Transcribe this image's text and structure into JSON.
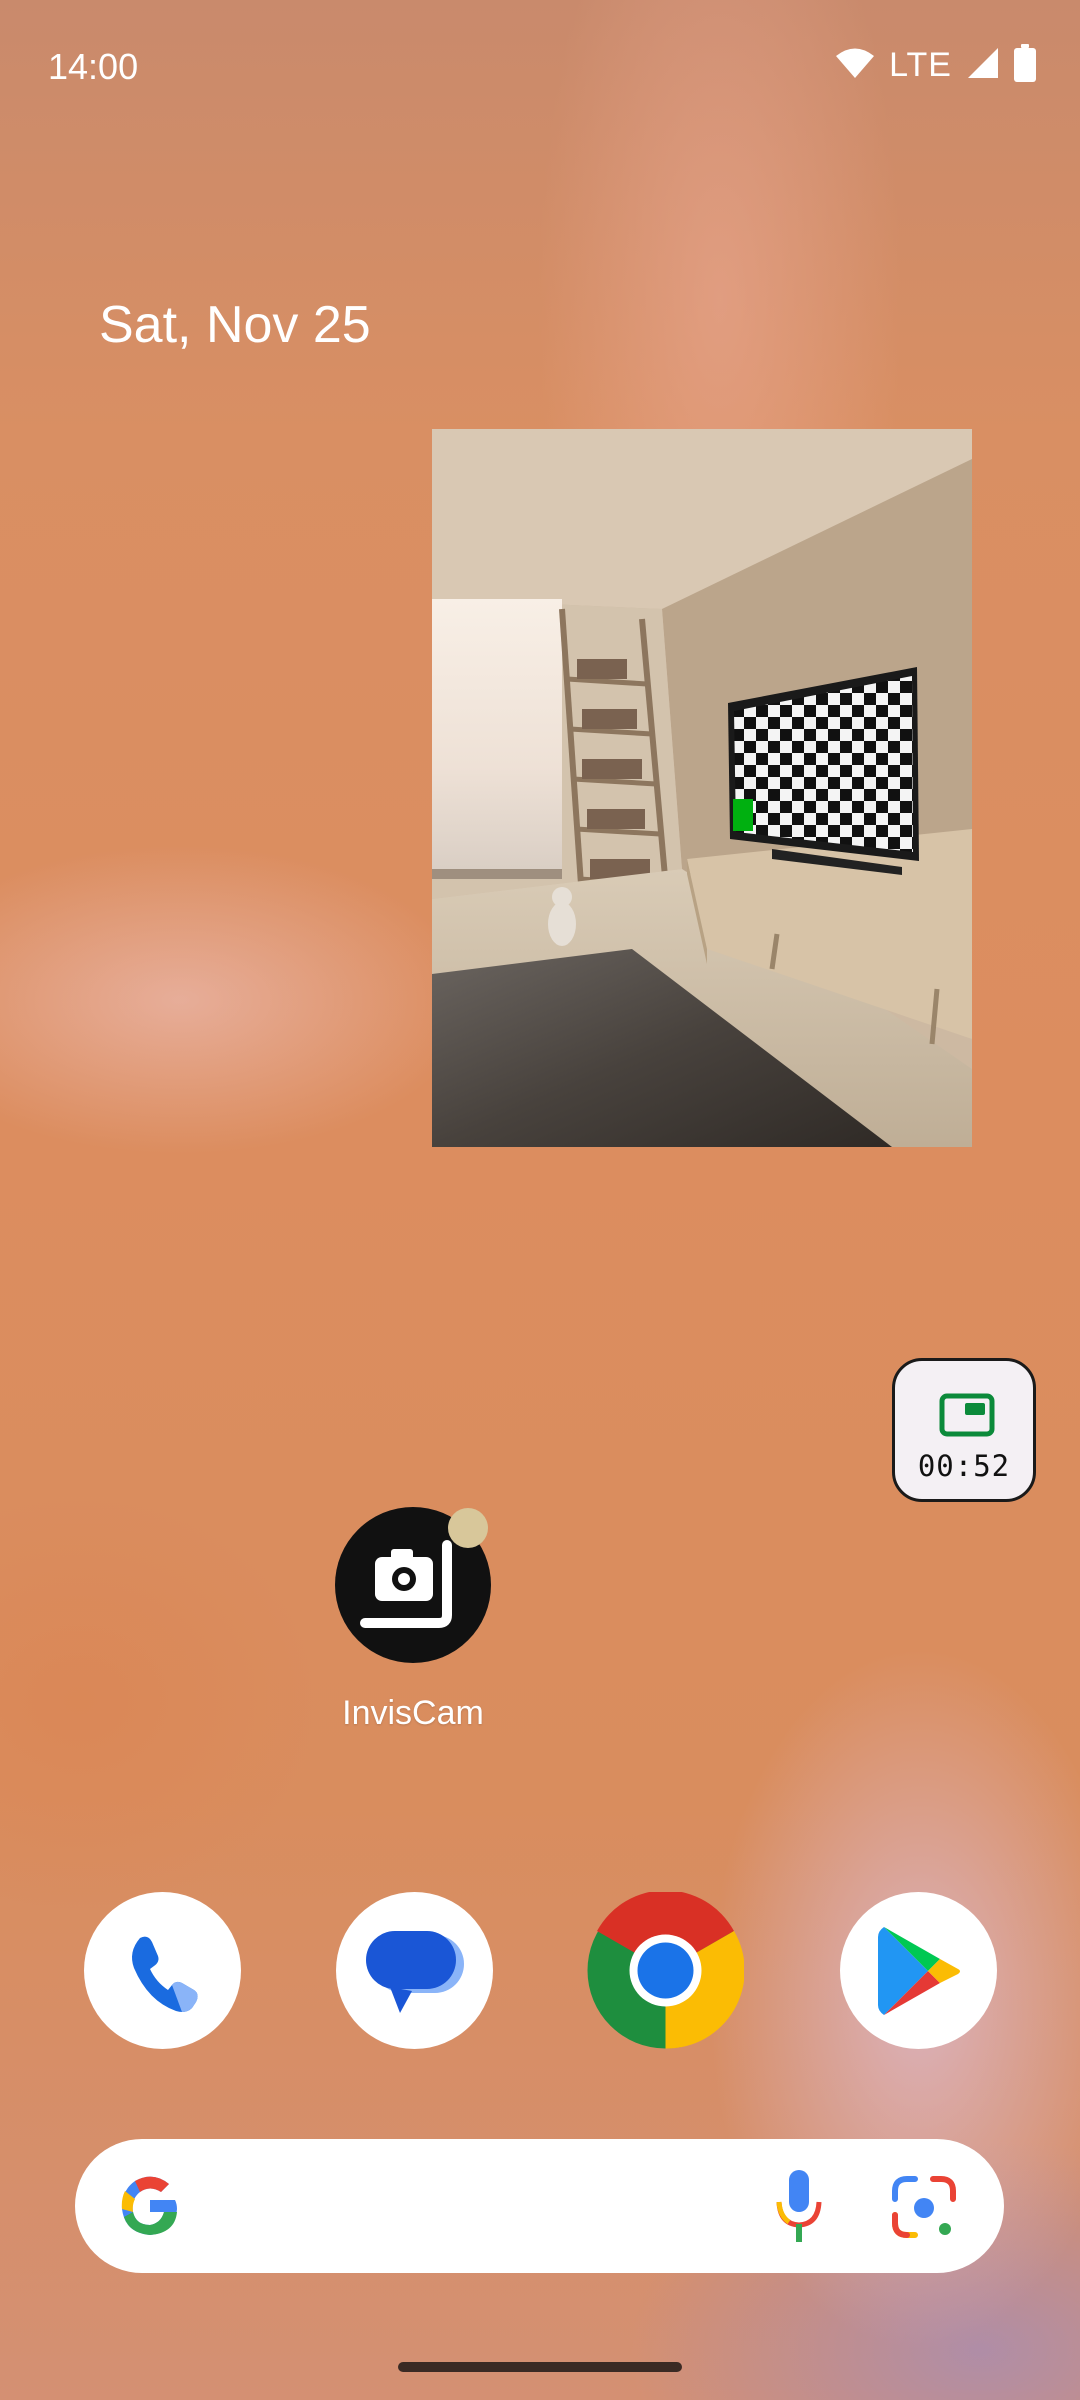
{
  "status_bar": {
    "time": "14:00",
    "network": "LTE",
    "icons": [
      "wifi-icon",
      "cell-signal-icon",
      "battery-icon"
    ]
  },
  "home": {
    "date": "Sat, Nov 25"
  },
  "pip_chip": {
    "icon": "picture-in-picture-icon",
    "timer": "00:52",
    "accent": "#0b8a3a"
  },
  "apps": [
    {
      "label": "InvisCam",
      "icon": "camera-icon",
      "has_notification_dot": true
    }
  ],
  "dock": [
    {
      "name": "Phone",
      "icon": "phone-icon"
    },
    {
      "name": "Messages",
      "icon": "messages-icon"
    },
    {
      "name": "Chrome",
      "icon": "chrome-icon"
    },
    {
      "name": "Play Store",
      "icon": "play-store-icon"
    }
  ],
  "search": {
    "icons": [
      "google-g-icon",
      "microphone-icon",
      "lens-icon"
    ]
  }
}
